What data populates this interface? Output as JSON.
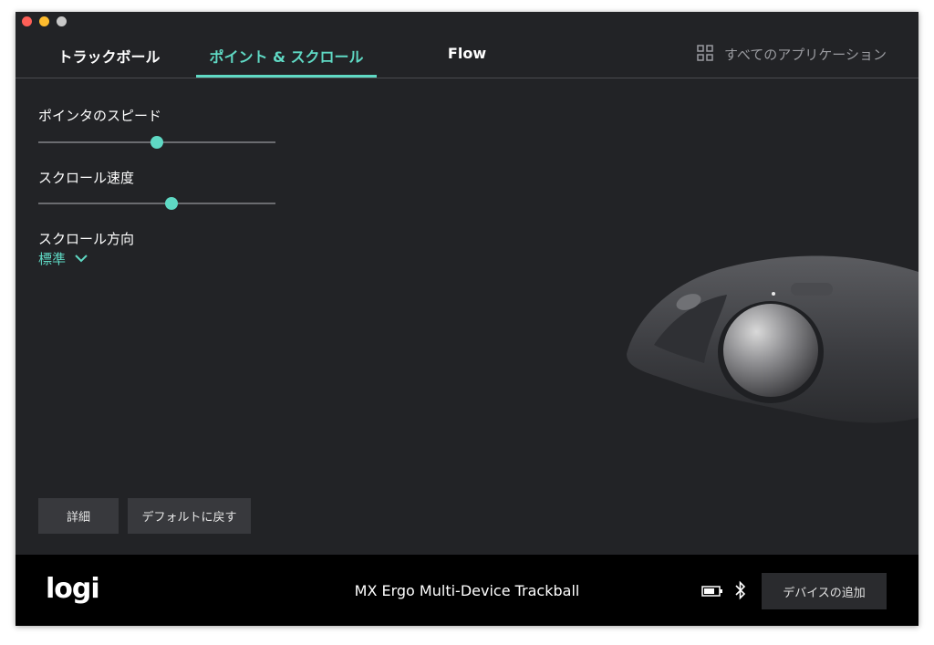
{
  "tabs": [
    {
      "label": "トラックボール",
      "active": false
    },
    {
      "label": "ポイント & スクロール",
      "active": true
    },
    {
      "label": "Flow",
      "active": false
    }
  ],
  "all_apps": {
    "label": "すべてのアプリケーション",
    "icon": "grid-icon"
  },
  "settings": {
    "pointer_speed": {
      "label": "ポインタのスピード",
      "value_fraction": 0.5
    },
    "scroll_speed": {
      "label": "スクロール速度",
      "value_fraction": 0.56
    },
    "scroll_direction": {
      "label": "スクロール方向",
      "value": "標準",
      "icon": "chevron-down-icon"
    }
  },
  "buttons": {
    "details": "詳細",
    "restore_default": "デフォルトに戻す"
  },
  "footer": {
    "logo": "logi",
    "device_name": "MX Ergo Multi-Device Trackball",
    "add_device": "デバイスの追加",
    "icons": [
      "battery-icon",
      "bluetooth-icon"
    ]
  },
  "colors": {
    "accent": "#5fd9c4",
    "background": "#222326",
    "footer": "#000000"
  }
}
